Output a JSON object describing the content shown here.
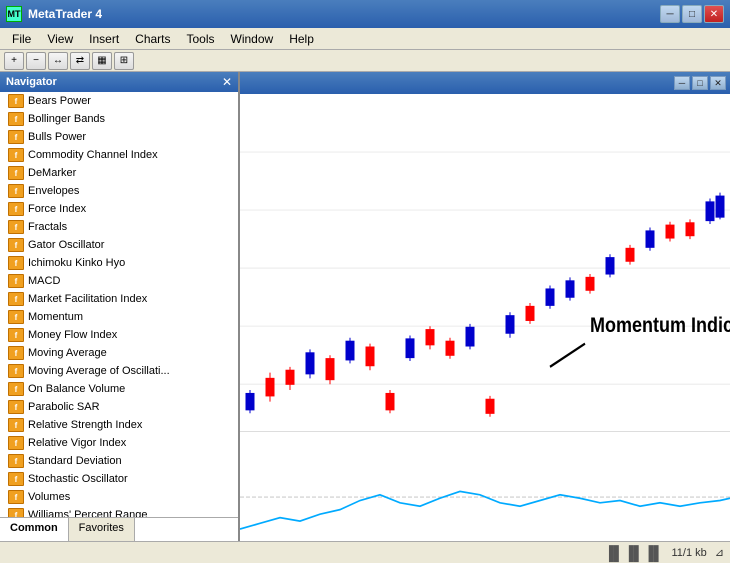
{
  "titlebar": {
    "title": "MetaTrader 4",
    "icon": "MT",
    "min_btn": "─",
    "max_btn": "□",
    "close_btn": "✕"
  },
  "menubar": {
    "items": [
      "File",
      "View",
      "Insert",
      "Charts",
      "Tools",
      "Window",
      "Help"
    ]
  },
  "navigator": {
    "title": "Navigator",
    "close_btn": "✕",
    "indicators": [
      "Bears Power",
      "Bollinger Bands",
      "Bulls Power",
      "Commodity Channel Index",
      "DeMarker",
      "Envelopes",
      "Force Index",
      "Fractals",
      "Gator Oscillator",
      "Ichimoku Kinko Hyo",
      "MACD",
      "Market Facilitation Index",
      "Momentum",
      "Money Flow Index",
      "Moving Average",
      "Moving Average of Oscillati...",
      "On Balance Volume",
      "Parabolic SAR",
      "Relative Strength Index",
      "Relative Vigor Index",
      "Standard Deviation",
      "Stochastic Oscillator",
      "Volumes",
      "Williams' Percent Range"
    ],
    "tabs": [
      "Common",
      "Favorites"
    ],
    "active_tab": "Common"
  },
  "chart": {
    "annotation": "Momentum Indicator"
  },
  "statusbar": {
    "icon": "▐▌▐▌▐▌",
    "info": "11/1 kb"
  },
  "inner_window": {
    "min_btn": "─",
    "max_btn": "□",
    "close_btn": "✕"
  }
}
